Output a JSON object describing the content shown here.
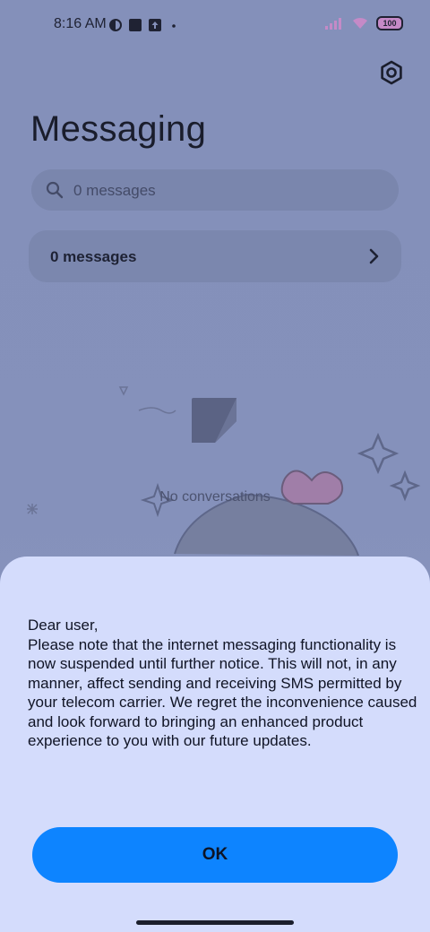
{
  "status_bar": {
    "time": "8:16 AM",
    "battery": "100"
  },
  "header": {
    "title": "Messaging",
    "settings_icon": "gear-icon"
  },
  "search": {
    "placeholder": "0 messages",
    "icon": "search-icon"
  },
  "messages_row": {
    "label": "0 messages",
    "icon": "chevron-right-icon"
  },
  "empty_state": {
    "text": "No conversations",
    "icon": "message-icon"
  },
  "dialog": {
    "notice": "Dear user,\nPlease note that the internet messaging functionality is now suspended until further notice. This will not, in any manner, affect sending and receiving SMS permitted by your telecom carrier. We regret the inconvenience caused and look forward to bringing an enhanced product experience to you with our future updates.",
    "ok_label": "OK"
  },
  "colors": {
    "accent": "#0d84ff",
    "sheet_background": "#d4dcfc",
    "dim_background": "#8490ba"
  }
}
